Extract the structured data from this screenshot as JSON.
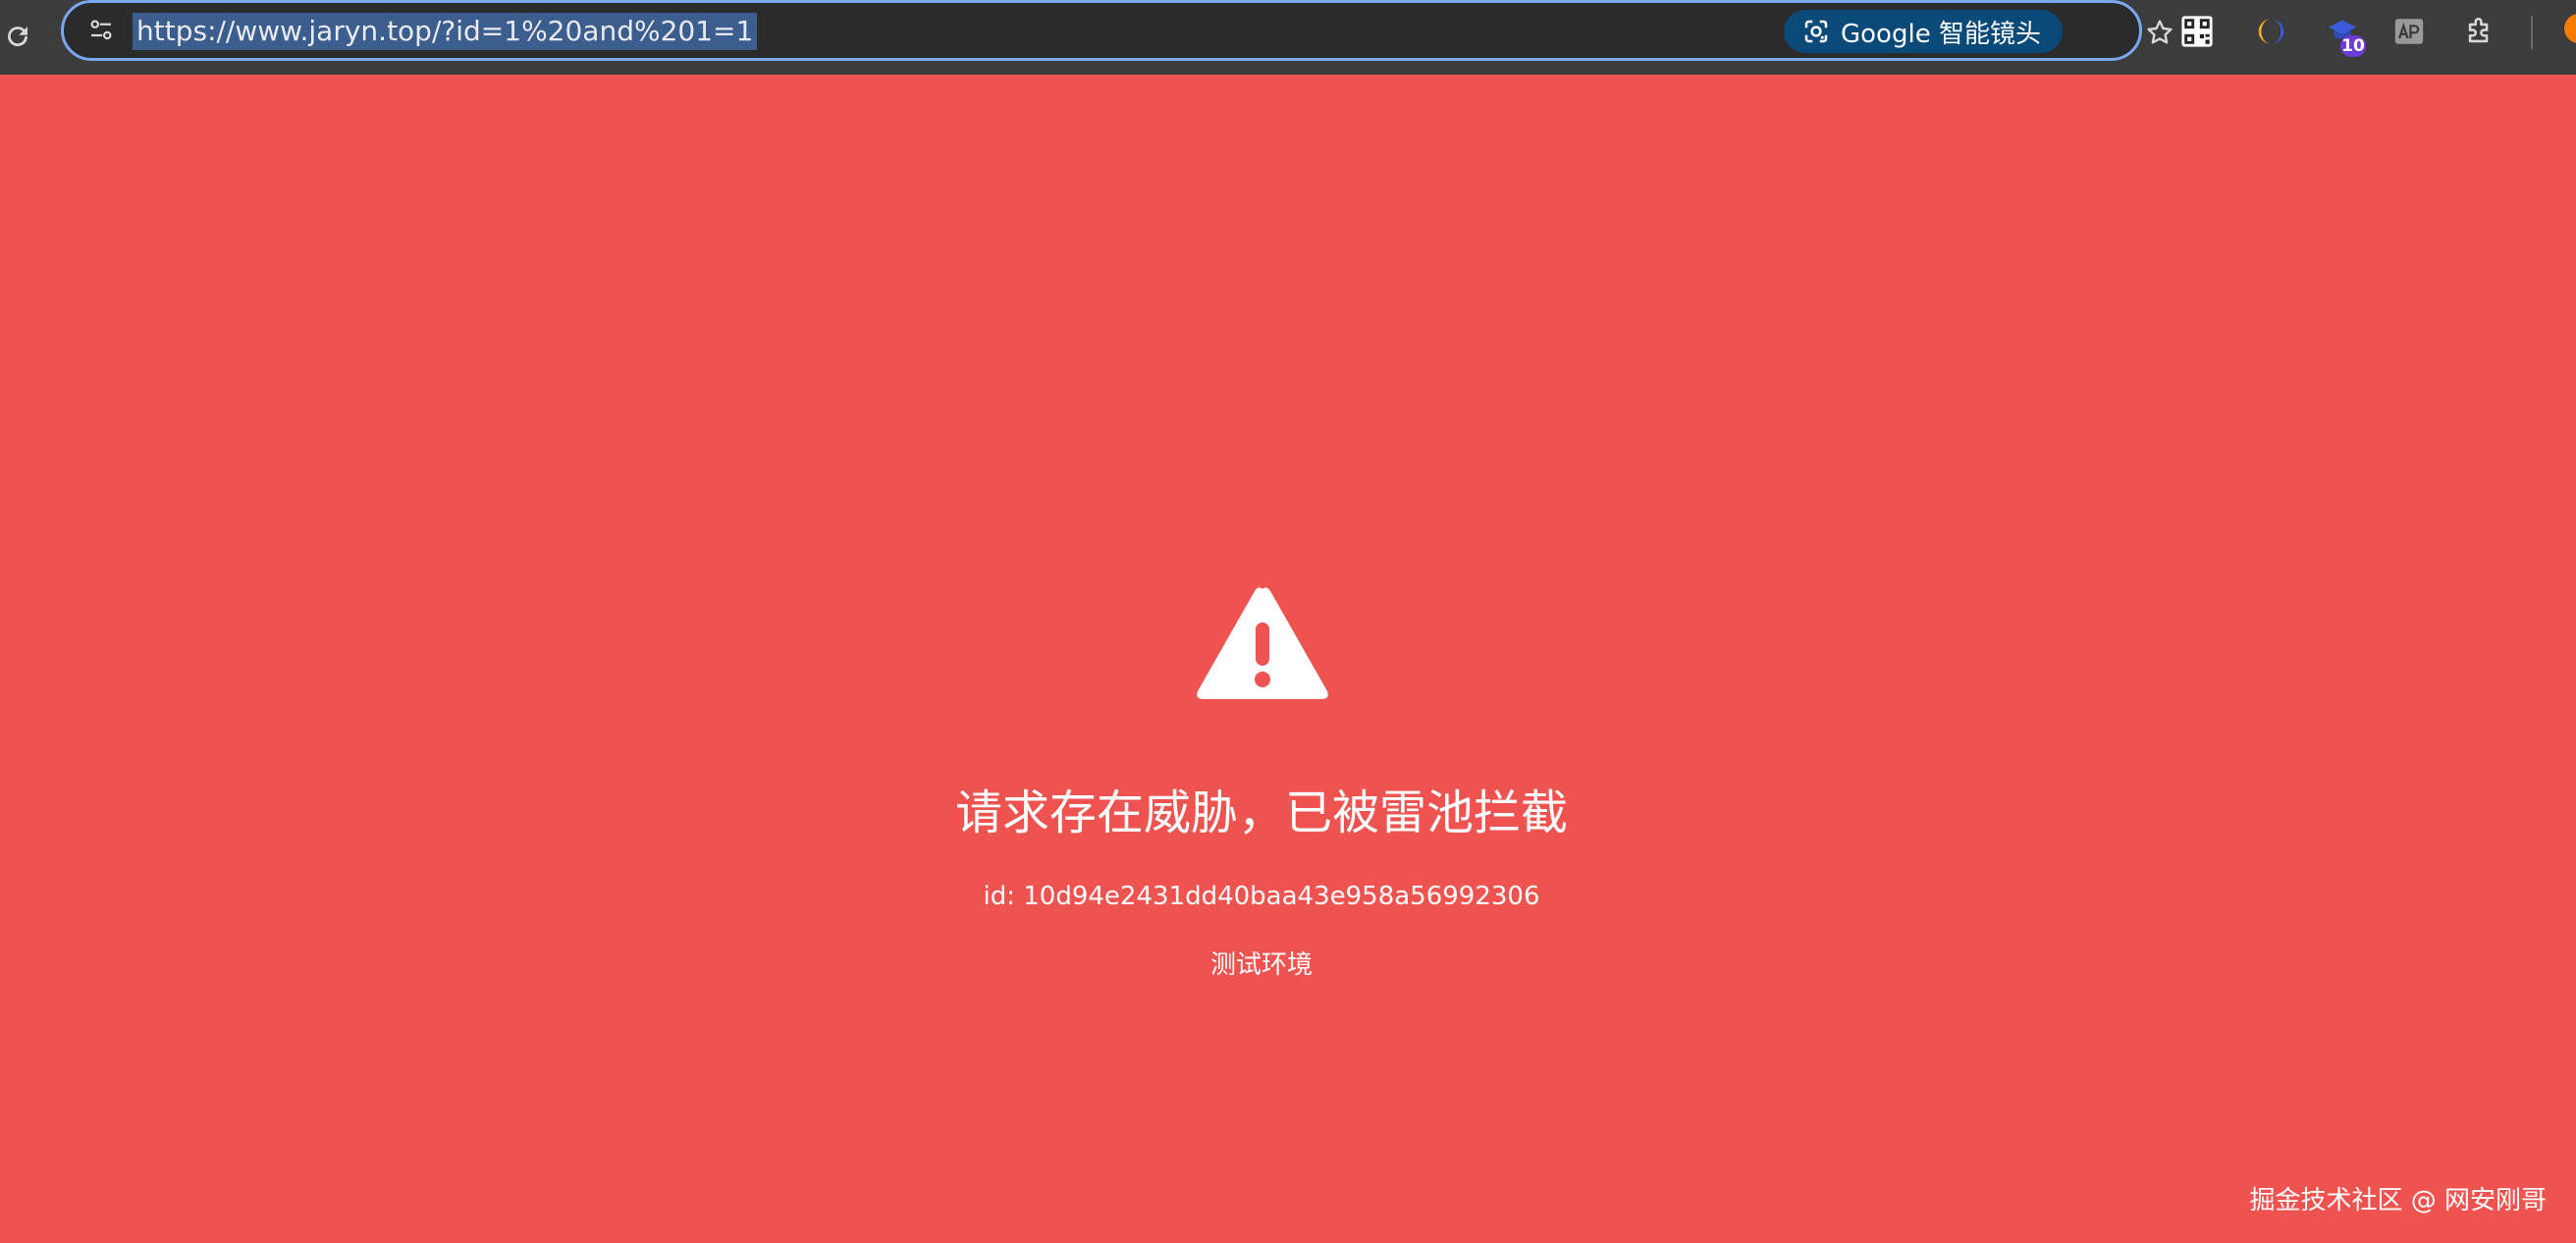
{
  "browser": {
    "url": "https://www.jaryn.top/?id=1%20and%201=1",
    "lens_label": "Google 智能镜头",
    "extension_badge": "10",
    "icons": {
      "reload": "reload-icon",
      "site_info": "tune-icon",
      "lens": "lens-camera-icon",
      "bookmark": "star-icon",
      "qr": "qr-code-icon",
      "ext_half_moon": "half-moon-icon",
      "ext_badge": "graduation-cap-icon",
      "ext_ap": "ap-icon",
      "extensions": "puzzle-icon"
    },
    "colors": {
      "toolbar": "#3c3c3c",
      "omnibox_border": "#7aa7f0",
      "url_selection": "#3c5e8f",
      "lens_chip": "#0a4a79",
      "badge": "#6c3bd9"
    }
  },
  "block_page": {
    "title": "请求存在威胁，已被雷池拦截",
    "request_id": "id: 10d94e2431dd40baa43e958a56992306",
    "environment": "测试环境",
    "watermark": "掘金技术社区 @ 网安刚哥",
    "icon": "warning-triangle-icon",
    "colors": {
      "background": "#ef5350",
      "text": "#ffffff"
    }
  }
}
